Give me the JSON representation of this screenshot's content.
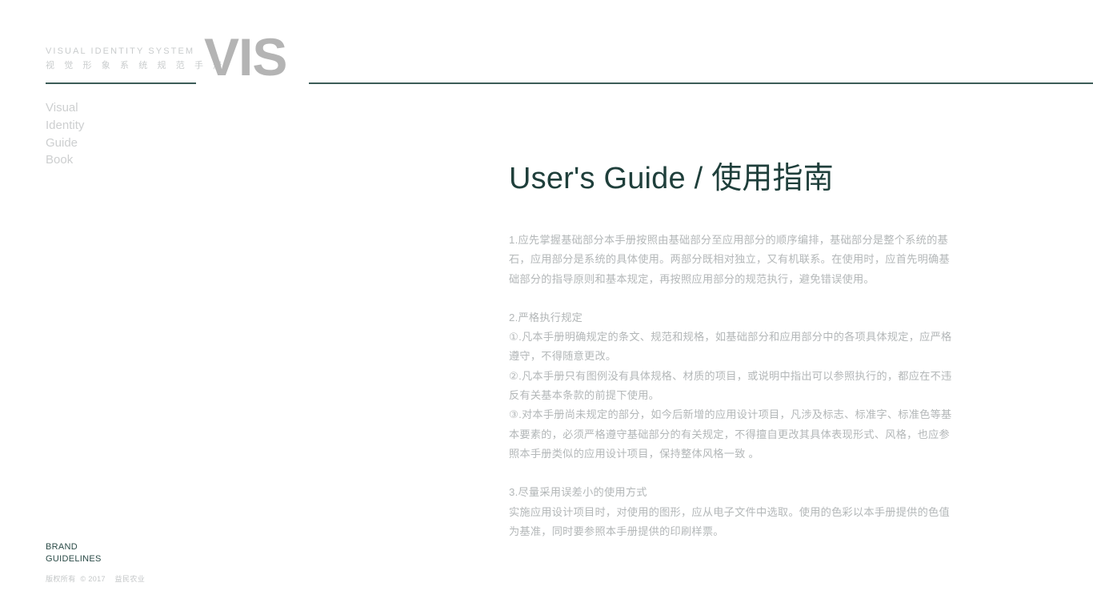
{
  "header": {
    "brand_en": "VISUAL  IDENTITY  SYSTEM",
    "brand_cn": "视 觉 形 象 系 统 规 范 手 册",
    "logo": "VIS"
  },
  "sidebar": {
    "items": [
      {
        "label": "Visual"
      },
      {
        "label": "Identity"
      },
      {
        "label": "Guide"
      },
      {
        "label": "Book"
      }
    ]
  },
  "footer": {
    "line1": "BRAND",
    "line2": "GUIDELINES",
    "copyright": "版权所有  © 2017    益民农业"
  },
  "main": {
    "title": "User's Guide / 使用指南",
    "sections": [
      {
        "id": "section-1",
        "lines": [
          "1.应先掌握基础部分本手册按照由基础部分至应用部分的顺序编排，基础部分是整个系统的基",
          "石，应用部分是系统的具体使用。两部分既相对独立，又有机联系。在使用时，应首先明确基",
          "础部分的指导原则和基本规定，再按照应用部分的规范执行，避免错误使用。"
        ]
      },
      {
        "id": "section-2",
        "lines": [
          "2.严格执行规定",
          "①.凡本手册明确规定的条文、规范和规格，如基础部分和应用部分中的各项具体规定，应严格",
          "遵守，不得随意更改。",
          "②.凡本手册只有图例没有具体规格、材质的项目，或说明中指出可以参照执行的，都应在不违",
          "反有关基本条款的前提下使用。",
          "③.对本手册尚未规定的部分，如今后新增的应用设计项目，凡涉及标志、标准字、标准色等基",
          "本要素的，必须严格遵守基础部分的有关规定，不得擅自更改其具体表现形式、风格，也应参",
          "照本手册类似的应用设计项目，保持整体风格一致 。"
        ]
      },
      {
        "id": "section-3",
        "lines": [
          "3.尽量采用误差小的使用方式",
          "实施应用设计项目时，对使用的图形，应从电子文件中选取。使用的色彩以本手册提供的色值",
          "为基准，同时要参照本手册提供的印刷样票。"
        ]
      }
    ]
  },
  "colors": {
    "accent_dark_teal": "#1f3f3b",
    "rule": "#3c5c58",
    "logo_gray": "#b4b4b4",
    "body_gray": "#b3b7b8",
    "sidebar_gray": "#cdcfd0",
    "background": "#ffffff"
  }
}
